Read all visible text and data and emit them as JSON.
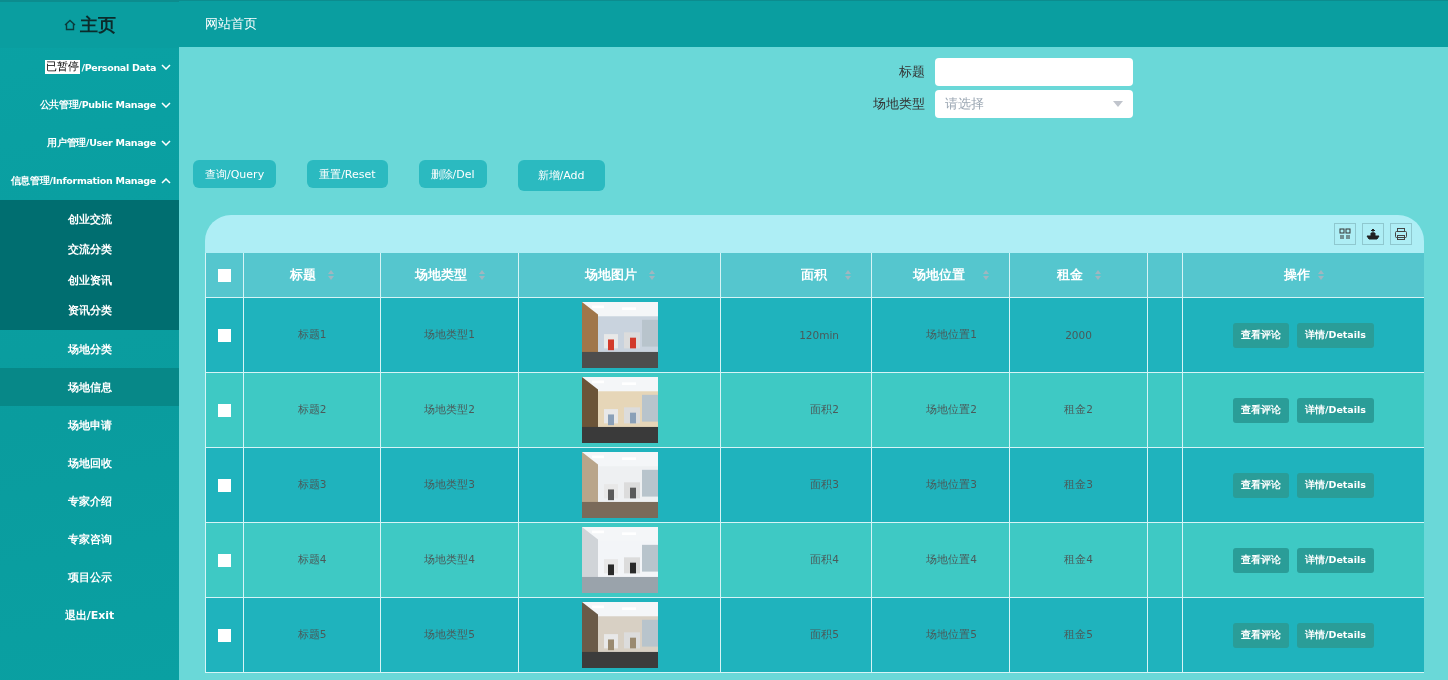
{
  "brand": {
    "title": "主页"
  },
  "topbar": {
    "link": "网站首页"
  },
  "paused_overlay": "已暂停",
  "menu": [
    {
      "label": "/Personal Data",
      "kind": "group",
      "expanded": false
    },
    {
      "label": "公共管理/Public Manage",
      "kind": "group",
      "expanded": false
    },
    {
      "label": "用户管理/User Manage",
      "kind": "group",
      "expanded": false
    },
    {
      "label": "信息管理/Information Manage",
      "kind": "group",
      "expanded": true,
      "children": [
        {
          "label": "创业交流",
          "selected": false
        },
        {
          "label": "交流分类",
          "selected": false
        },
        {
          "label": "创业资讯",
          "selected": false
        },
        {
          "label": "资讯分类",
          "selected": false
        }
      ]
    },
    {
      "label": "场地分类",
      "kind": "item",
      "selected": false
    },
    {
      "label": "场地信息",
      "kind": "item",
      "selected": true
    },
    {
      "label": "场地申请",
      "kind": "item",
      "selected": false
    },
    {
      "label": "场地回收",
      "kind": "item",
      "selected": false
    },
    {
      "label": "专家介绍",
      "kind": "item",
      "selected": false
    },
    {
      "label": "专家咨询",
      "kind": "item",
      "selected": false
    },
    {
      "label": "项目公示",
      "kind": "item",
      "selected": false
    },
    {
      "label": "退出/Exit",
      "kind": "item",
      "selected": false
    }
  ],
  "search": {
    "fields": [
      {
        "label": "标题",
        "kind": "text"
      },
      {
        "label": "场地类型",
        "kind": "select",
        "placeholder": "请选择"
      }
    ]
  },
  "actions": [
    "查询/Query",
    "重置/Reset",
    "删除/Del",
    "新增/Add"
  ],
  "table": {
    "select_all_checked": false,
    "columns": [
      "标题",
      "场地类型",
      "场地图片",
      "面积",
      "场地位置",
      "租金",
      "操作"
    ],
    "rows": [
      {
        "checked": false,
        "title": "标题1",
        "type": "场地类型1",
        "area": "120min",
        "location": "场地位置1",
        "rent": "2000",
        "buttons": [
          "查看评论",
          "详情/Details"
        ]
      },
      {
        "checked": false,
        "title": "标题2",
        "type": "场地类型2",
        "area": "面积2",
        "location": "场地位置2",
        "rent": "租金2",
        "buttons": [
          "查看评论",
          "详情/Details"
        ]
      },
      {
        "checked": false,
        "title": "标题3",
        "type": "场地类型3",
        "area": "面积3",
        "location": "场地位置3",
        "rent": "租金3",
        "buttons": [
          "查看评论",
          "详情/Details"
        ]
      },
      {
        "checked": false,
        "title": "标题4",
        "type": "场地类型4",
        "area": "面积4",
        "location": "场地位置4",
        "rent": "租金4",
        "buttons": [
          "查看评论",
          "详情/Details"
        ]
      },
      {
        "checked": false,
        "title": "标题5",
        "type": "场地类型5",
        "area": "面积5",
        "location": "场地位置5",
        "rent": "租金5",
        "buttons": [
          "查看评论",
          "详情/Details"
        ]
      }
    ]
  }
}
